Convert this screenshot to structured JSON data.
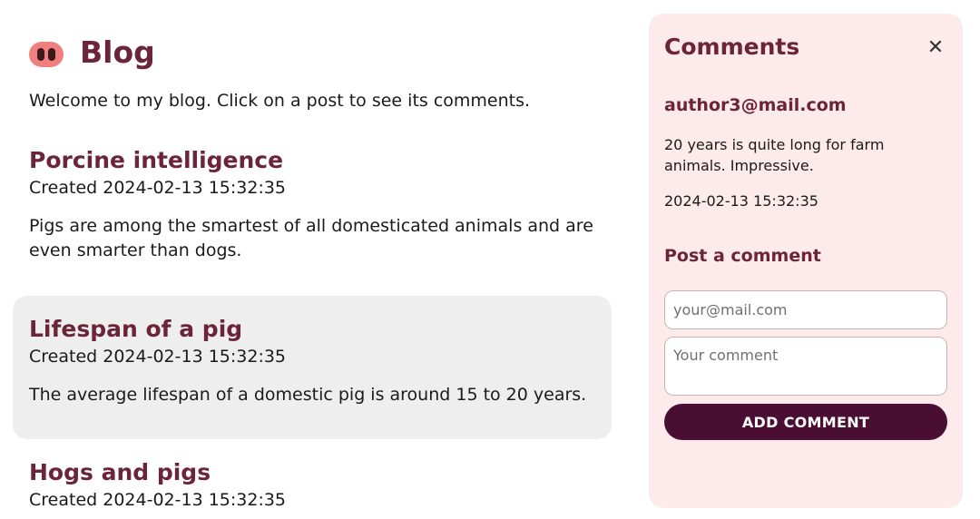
{
  "header": {
    "title": "Blog",
    "logo_icon": "pig-snout-icon",
    "intro": "Welcome to my blog. Click on a post to see its comments."
  },
  "posts": [
    {
      "title": "Porcine intelligence",
      "created": "Created 2024-02-13 15:32:35",
      "body": "Pigs are among the smartest of all domesticated animals and are even smarter than dogs.",
      "selected": false
    },
    {
      "title": "Lifespan of a pig",
      "created": "Created 2024-02-13 15:32:35",
      "body": "The average lifespan of a domestic pig is around 15 to 20 years.",
      "selected": true
    },
    {
      "title": "Hogs and pigs",
      "created": "Created 2024-02-13 15:32:35",
      "body": "",
      "selected": false
    }
  ],
  "comments": {
    "title": "Comments",
    "close_icon": "close-icon",
    "items": [
      {
        "author": "author3@mail.com",
        "text": "20 years is quite long for farm animals. Impressive.",
        "date": "2024-02-13 15:32:35"
      }
    ],
    "form": {
      "title": "Post a comment",
      "email_placeholder": "your@mail.com",
      "comment_placeholder": "Your comment",
      "submit_label": "ADD COMMENT"
    }
  },
  "colors": {
    "accent": "#6b2439",
    "button": "#4a0e32",
    "panel_bg": "#fdeaea",
    "selected_bg": "#eeeeee"
  }
}
